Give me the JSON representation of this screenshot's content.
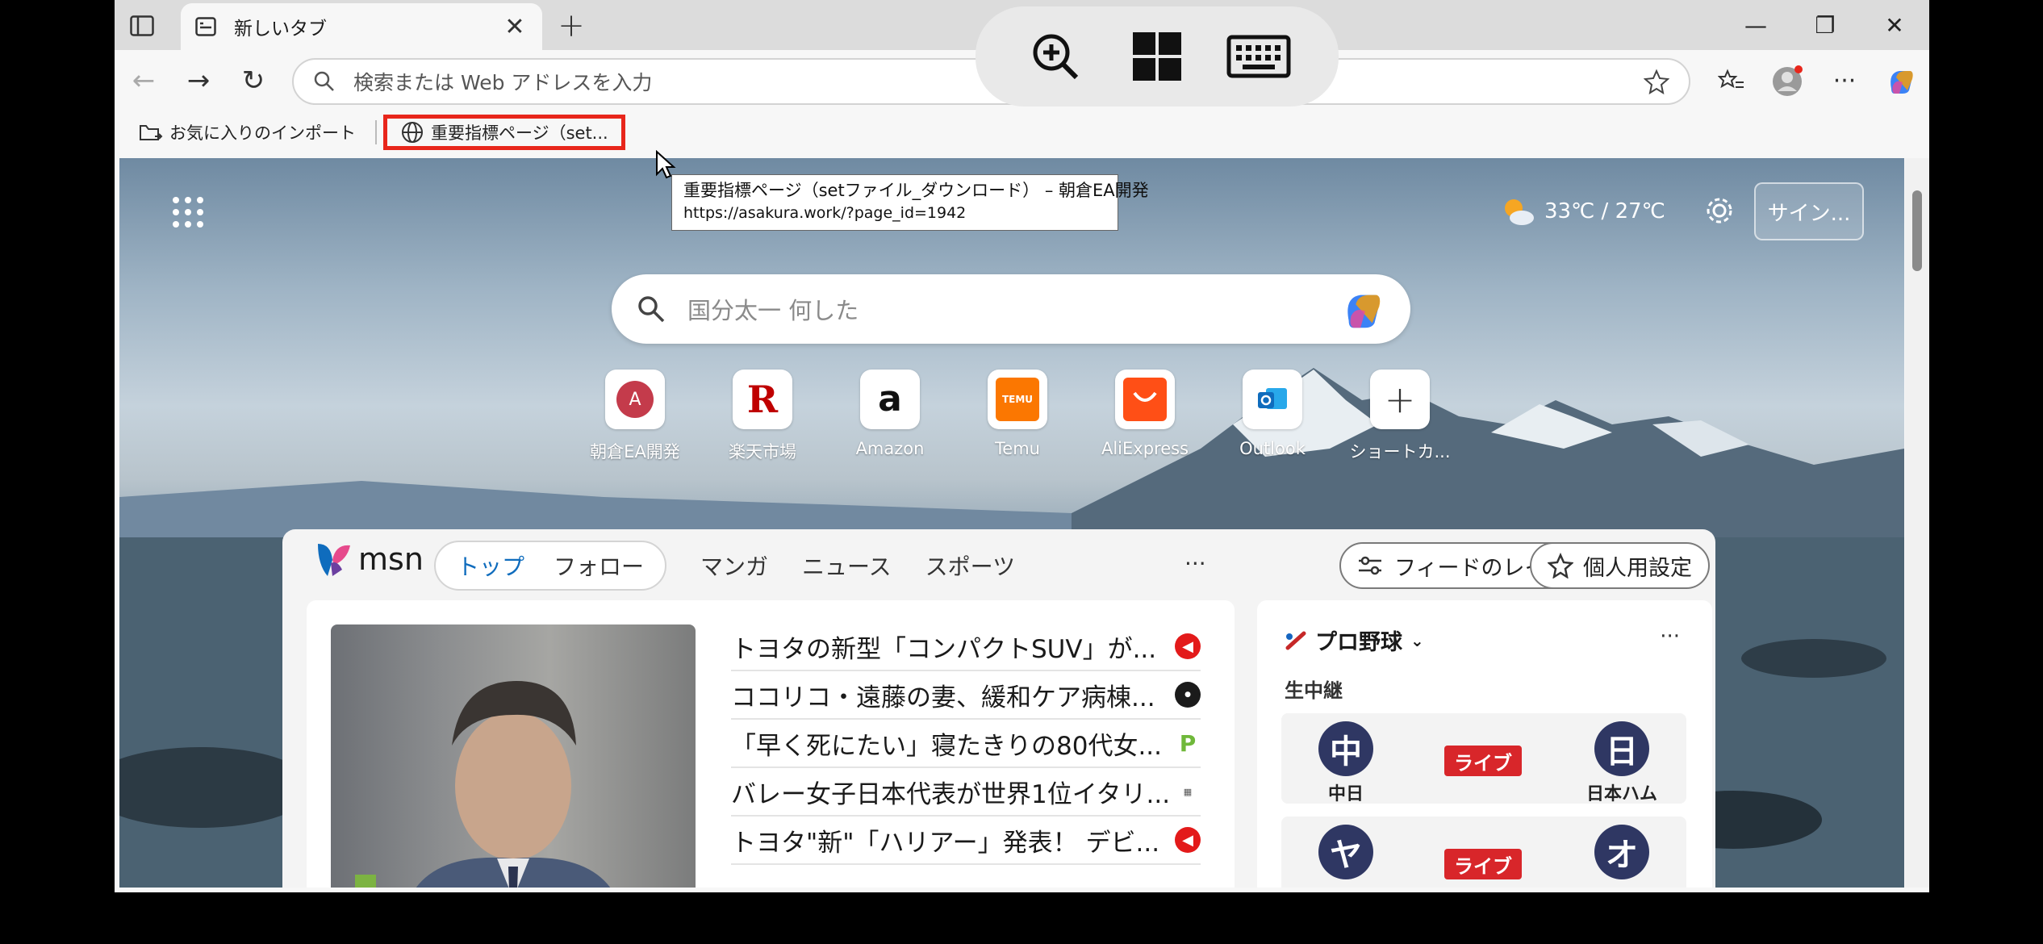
{
  "tab": {
    "title": "新しいタブ",
    "close_glyph": "✕",
    "new_glyph": "+"
  },
  "window": {
    "minimize_glyph": "—",
    "restore_glyph": "❐",
    "close_glyph": "✕"
  },
  "nav": {
    "back_glyph": "←",
    "forward_glyph": "→",
    "reload_glyph": "↻"
  },
  "address": {
    "placeholder": "検索または Web アドレスを入力"
  },
  "toolbar": {
    "more_glyph": "···"
  },
  "bookmarks": {
    "import_label": "お気に入りのインポート",
    "page_label": "重要指標ページ（set..."
  },
  "tooltip": {
    "title": "重要指標ページ（setファイル_ダウンロード） – 朝倉EA開発",
    "url": "https://asakura.work/?page_id=1942"
  },
  "newtab": {
    "weather": "33℃ / 27℃",
    "signin_label": "サイン...",
    "search_placeholder": "国分太一 何した",
    "shortcuts": [
      {
        "label": "朝倉EA開発",
        "tile_text": "A",
        "color": "#c43b4b"
      },
      {
        "label": "楽天市場",
        "tile_text": "R",
        "color": "#bf0000"
      },
      {
        "label": "Amazon",
        "tile_text": "a",
        "color": "#111111"
      },
      {
        "label": "Temu",
        "tile_text": "TEMU",
        "color": "#fb7701"
      },
      {
        "label": "AliExpress",
        "tile_text": "",
        "color": "#ff4f16"
      },
      {
        "label": "Outlook",
        "tile_text": "",
        "color": "#0f6cbd"
      },
      {
        "label": "ショートカ...",
        "tile_text": "+",
        "color": "#333333"
      }
    ]
  },
  "feed": {
    "brand": "msn",
    "tabs": [
      "トップ",
      "フォロー"
    ],
    "links": [
      "マンガ",
      "ニュース",
      "スポーツ"
    ],
    "more": "···",
    "layout_button": "フィードのレイアウト",
    "personalize_button": "個人用設定",
    "headlines": [
      {
        "text": "トヨタの新型「コンパクトSUV」が...",
        "source_color": "#e31a1a"
      },
      {
        "text": "ココリコ・遠藤の妻、緩和ケア病棟...",
        "source_color": "#1b1b1b"
      },
      {
        "text": "「早く死にたい」寝たきりの80代女...",
        "source_color": "#6fb83a"
      },
      {
        "text": "バレー女子日本代表が世界1位イタリ...",
        "source_color": "#888888"
      },
      {
        "text": "トヨタ\"新\"「ハリアー」発表！ デビ...",
        "source_color": "#e31a1a"
      }
    ],
    "sports": {
      "title": "プロ野球",
      "subtitle": "生中継",
      "dots": "···",
      "live_label": "ライブ",
      "matches": [
        {
          "home_badge": "中",
          "home_name": "中日",
          "away_badge": "日",
          "away_name": "日本ハム"
        },
        {
          "home_badge": "ヤ",
          "home_name": "",
          "away_badge": "オ",
          "away_name": ""
        }
      ]
    }
  },
  "colors": {
    "accent": "#0f6cbd",
    "highlight": "#e8261b",
    "live": "#d8262a"
  }
}
